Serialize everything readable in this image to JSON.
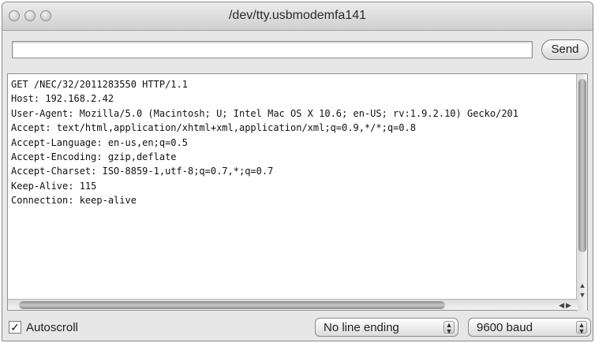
{
  "window": {
    "title": "/dev/tty.usbmodemfa141"
  },
  "send": {
    "input_value": "",
    "button_label": "Send"
  },
  "console": {
    "lines": [
      "GET /NEC/32/2011283550 HTTP/1.1",
      "Host: 192.168.2.42",
      "User-Agent: Mozilla/5.0 (Macintosh; U; Intel Mac OS X 10.6; en-US; rv:1.9.2.10) Gecko/201",
      "Accept: text/html,application/xhtml+xml,application/xml;q=0.9,*/*;q=0.8",
      "Accept-Language: en-us,en;q=0.5",
      "Accept-Encoding: gzip,deflate",
      "Accept-Charset: ISO-8859-1,utf-8;q=0.7,*;q=0.7",
      "Keep-Alive: 115",
      "Connection: keep-alive"
    ]
  },
  "footer": {
    "autoscroll_label": "Autoscroll",
    "autoscroll_checked": true,
    "line_ending": "No line ending",
    "baud_rate": "9600 baud"
  }
}
